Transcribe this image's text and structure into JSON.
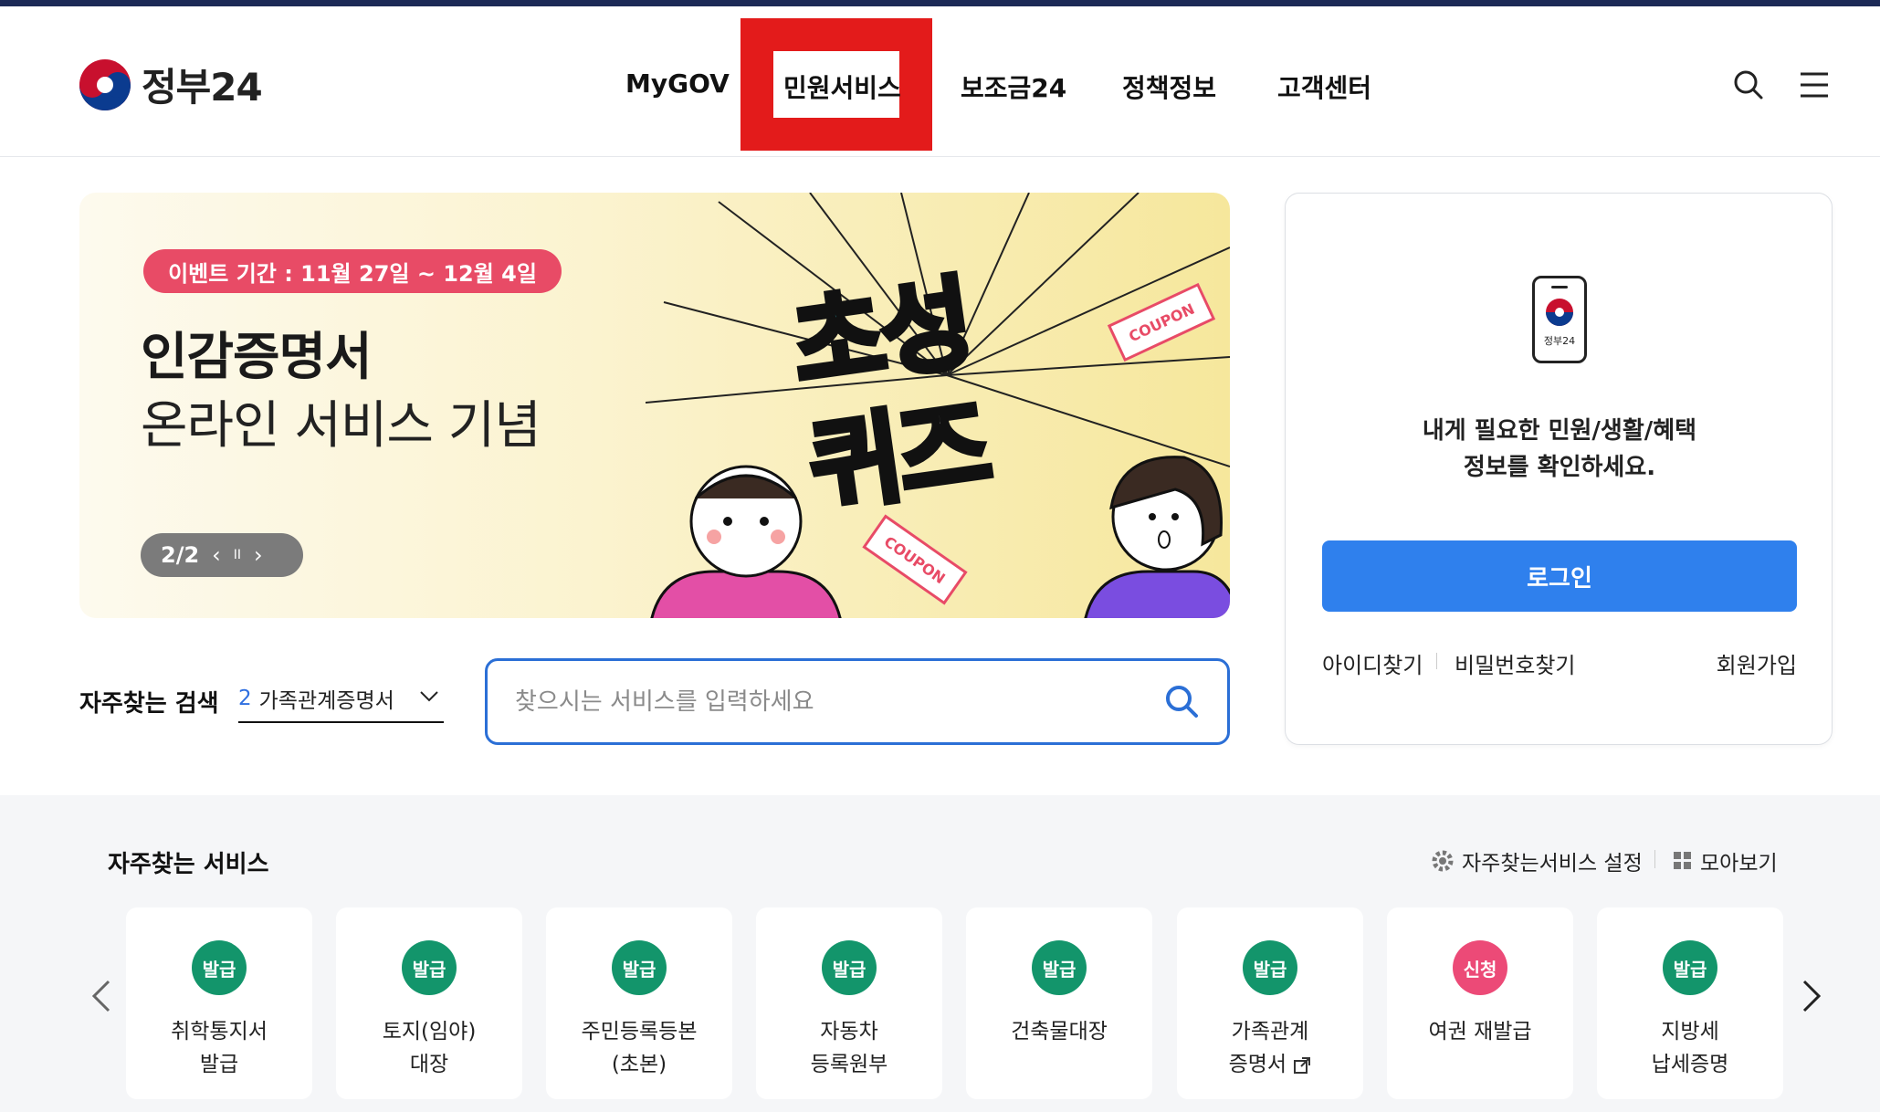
{
  "header": {
    "logo_text": "정부24",
    "nav": [
      "MyGOV",
      "민원서비스",
      "보조금24",
      "정책정보",
      "고객센터"
    ],
    "highlight_color": "#e31b1b"
  },
  "banner": {
    "event_period": "이벤트 기간 : 11월 27일 ~ 12월 4일",
    "title_line1": "인감증명서",
    "title_line2": "온라인 서비스 기념",
    "quiz_line1": "초성",
    "quiz_line2": "퀴즈",
    "coupon_label": "COUPON",
    "pager_text": "2/2",
    "pager_prev": "‹",
    "pager_pause": "II",
    "pager_next": "›"
  },
  "search": {
    "freq_label": "자주찾는 검색",
    "freq_rank": "2",
    "freq_term": "가족관계증명서",
    "placeholder": "찾으시는 서비스를 입력하세요"
  },
  "login": {
    "phone_label": "정부24",
    "desc_line1": "내게 필요한 민원/생활/혜택",
    "desc_line2": "정보를 확인하세요.",
    "login_button": "로그인",
    "find_id": "아이디찾기",
    "find_pw": "비밀번호찾기",
    "signup": "회원가입"
  },
  "services": {
    "title": "자주찾는 서비스",
    "settings_label": "자주찾는서비스 설정",
    "view_all_label": "모아보기",
    "cards": [
      {
        "badge": "발급",
        "label": "취학통지서\n발급",
        "badge_color": "green"
      },
      {
        "badge": "발급",
        "label": "토지(임야)\n대장",
        "badge_color": "green"
      },
      {
        "badge": "발급",
        "label": "주민등록등본\n(초본)",
        "badge_color": "green"
      },
      {
        "badge": "발급",
        "label": "자동차\n등록원부",
        "badge_color": "green"
      },
      {
        "badge": "발급",
        "label": "건축물대장",
        "badge_color": "green"
      },
      {
        "badge": "발급",
        "label": "가족관계\n증명서",
        "badge_color": "green"
      },
      {
        "badge": "신청",
        "label": "여권 재발급",
        "badge_color": "pink"
      },
      {
        "badge": "발급",
        "label": "지방세\n납세증명",
        "badge_color": "green"
      }
    ]
  }
}
